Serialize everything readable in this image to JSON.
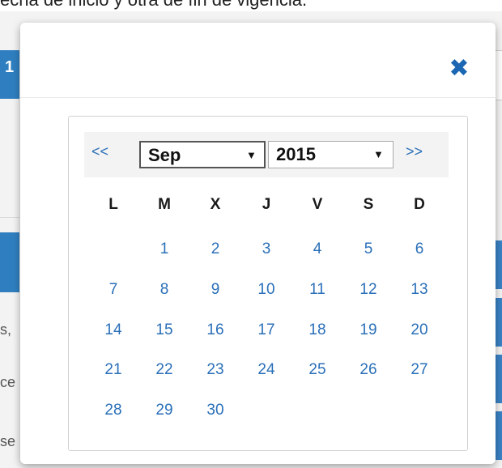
{
  "background": {
    "top_text": "echa de inicio y otra de fin de vigencia.",
    "left_blue_label": "1",
    "row_snippets": [
      "s,",
      "ce",
      "se"
    ]
  },
  "modal": {
    "close_icon": "close-x-icon",
    "close_glyph": "✖"
  },
  "calendar": {
    "prev_label": "<<",
    "next_label": ">>",
    "month_value": "Sep",
    "year_value": "2015",
    "dropdown_glyph": "▼",
    "weekdays": [
      "L",
      "M",
      "X",
      "J",
      "V",
      "S",
      "D"
    ],
    "weeks": [
      [
        "",
        "1",
        "2",
        "3",
        "4",
        "5",
        "6"
      ],
      [
        "7",
        "8",
        "9",
        "10",
        "11",
        "12",
        "13"
      ],
      [
        "14",
        "15",
        "16",
        "17",
        "18",
        "19",
        "20"
      ],
      [
        "21",
        "22",
        "23",
        "24",
        "25",
        "26",
        "27"
      ],
      [
        "28",
        "29",
        "30",
        "",
        "",
        "",
        ""
      ]
    ]
  },
  "colors": {
    "accent": "#2a6fb8",
    "close": "#1b67b3",
    "background_blue": "#2f7fc0"
  }
}
